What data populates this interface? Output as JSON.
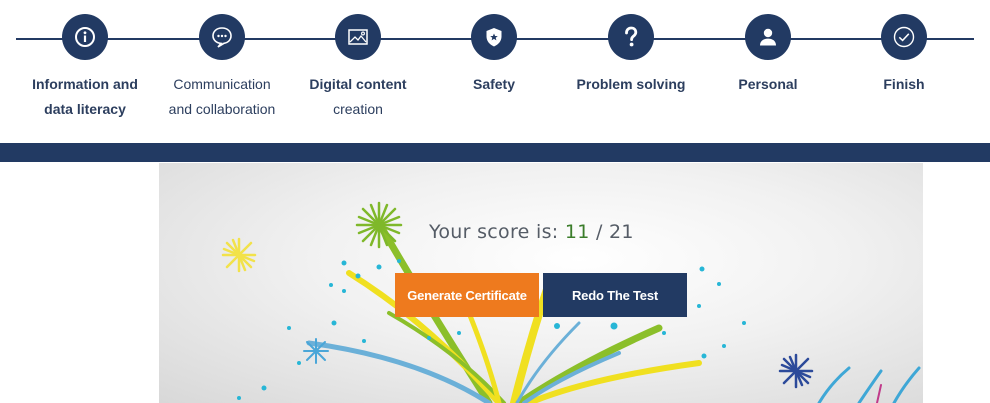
{
  "steps": [
    {
      "icon": "info-icon",
      "lines": [
        "Information and",
        "data literacy"
      ]
    },
    {
      "icon": "chat-bubble-icon",
      "lines": [
        "Communication",
        "and collaboration"
      ]
    },
    {
      "icon": "image-icon",
      "lines": [
        "Digital content",
        "creation"
      ]
    },
    {
      "icon": "shield-icon",
      "lines": [
        "Safety"
      ]
    },
    {
      "icon": "question-icon",
      "lines": [
        "Problem solving"
      ]
    },
    {
      "icon": "person-icon",
      "lines": [
        "Personal"
      ]
    },
    {
      "icon": "checkmark-circle-icon",
      "lines": [
        "Finish"
      ]
    }
  ],
  "result": {
    "score_prefix": "Your score is:",
    "score_value": "11",
    "score_separator": "/",
    "score_total": "21",
    "generate_certificate_label": "Generate Certificate",
    "redo_test_label": "Redo The Test"
  },
  "colors": {
    "navy": "#223a63",
    "orange": "#ee7a1e",
    "score_green": "#3b7d2a"
  }
}
